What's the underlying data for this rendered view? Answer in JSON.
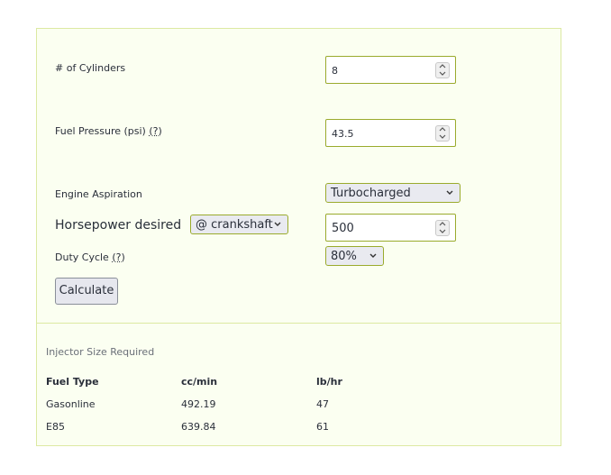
{
  "form": {
    "cylinders_label": "# of Cylinders",
    "cylinders_value": "8",
    "fuel_pressure_label": "Fuel Pressure (psi)",
    "fuel_pressure_help": "(?)",
    "fuel_pressure_value": "43.5",
    "aspiration_label": "Engine Aspiration",
    "aspiration_selected": "Turbocharged",
    "horsepower_label": "Horsepower desired",
    "horsepower_location_selected": "@ crankshaft",
    "horsepower_value": "500",
    "duty_cycle_label": "Duty Cycle",
    "duty_cycle_help": "(?)",
    "duty_cycle_selected": "80%",
    "calculate_label": "Calculate"
  },
  "results": {
    "title": "Injector Size Required",
    "columns": [
      "Fuel Type",
      "cc/min",
      "lb/hr"
    ],
    "rows": [
      [
        "Gasonline",
        "492.19",
        "47"
      ],
      [
        "E85",
        "639.84",
        "61"
      ]
    ]
  },
  "colors": {
    "panel_bg": "#fbfff1",
    "panel_border": "#dce9a2",
    "input_border": "#9aab2d"
  }
}
